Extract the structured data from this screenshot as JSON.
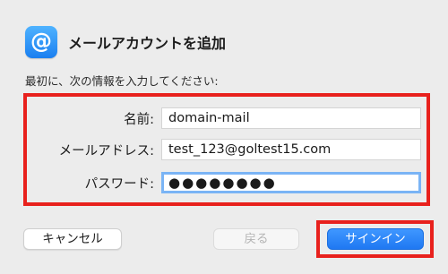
{
  "dialog": {
    "icon_symbol": "@",
    "icon_name": "mail-at-icon",
    "title": "メールアカウントを追加",
    "subtitle": "最初に、次の情報を入力してください:"
  },
  "form": {
    "name": {
      "label": "名前:",
      "value": "domain-mail"
    },
    "email": {
      "label": "メールアドレス:",
      "value": "test_123@goltest15.com"
    },
    "password": {
      "label": "パスワード:",
      "value": "●●●●●●●●"
    }
  },
  "buttons": {
    "cancel": "キャンセル",
    "back": "戻る",
    "signin": "サインイン"
  },
  "colors": {
    "highlight": "#e8211d",
    "accent": "#1f78f2",
    "focus_ring": "#7ab4f5"
  }
}
